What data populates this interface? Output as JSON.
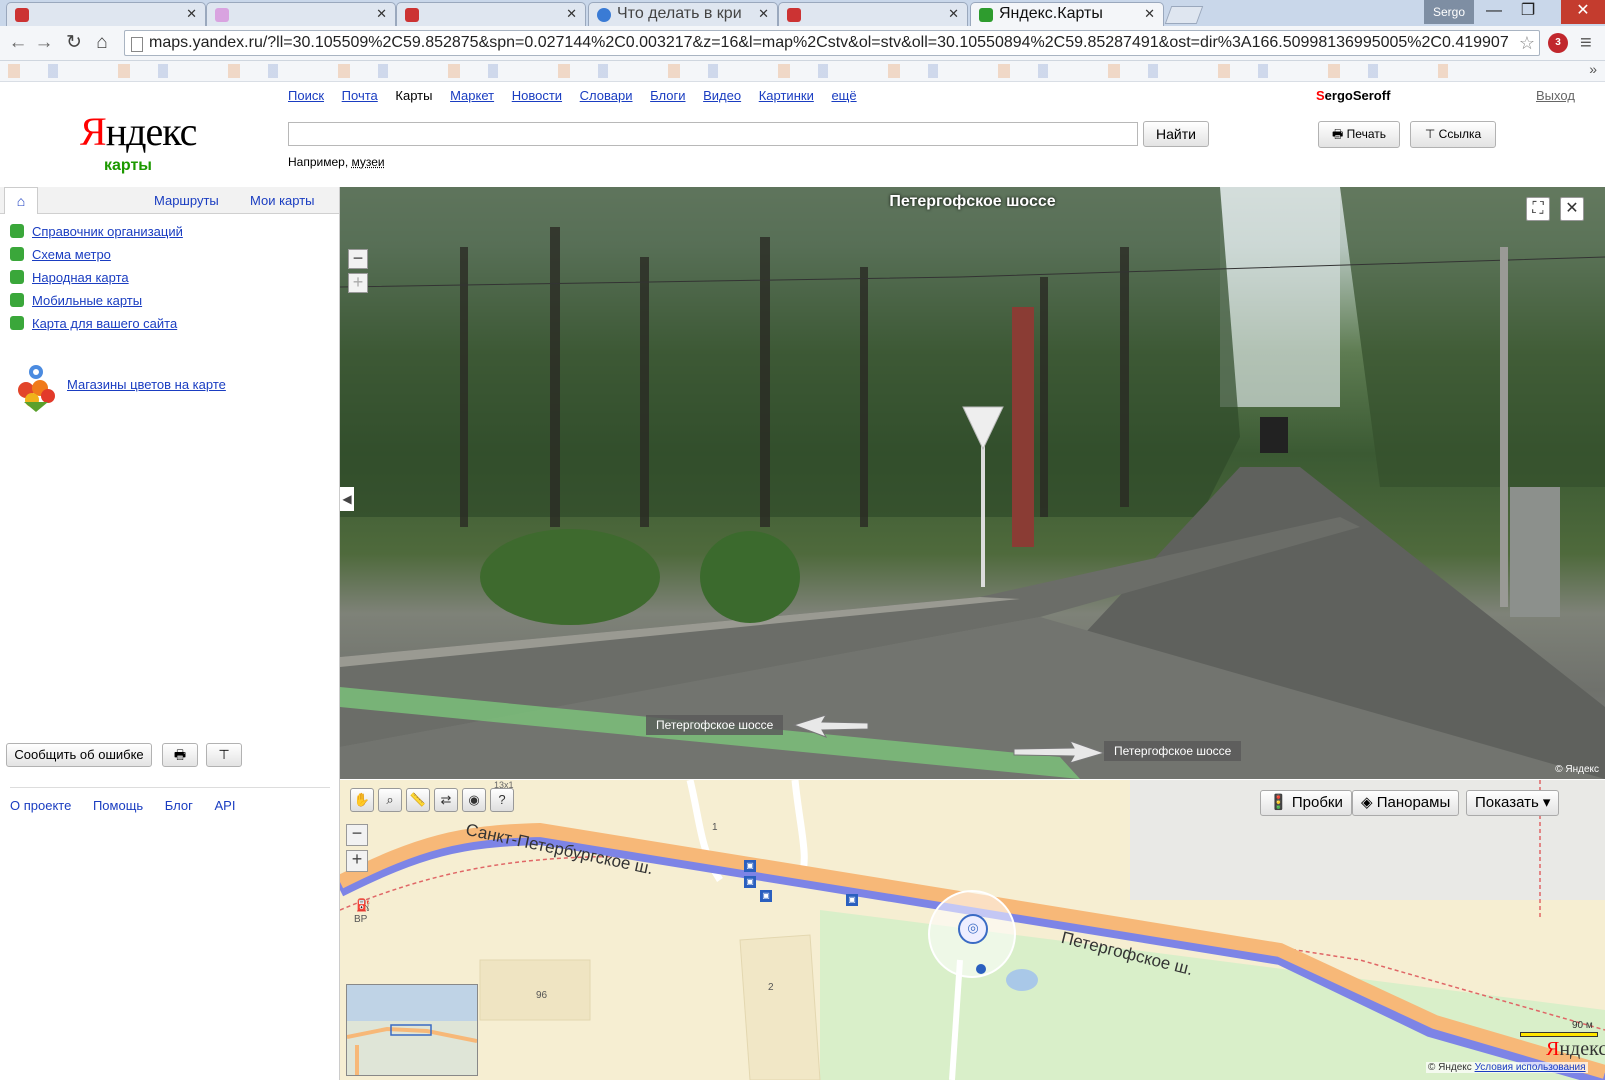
{
  "browser": {
    "tabs": [
      {
        "label": "",
        "state": "redacted"
      },
      {
        "label": "",
        "state": "redacted"
      },
      {
        "label": "",
        "state": "redacted"
      },
      {
        "label": "Что делать в кри",
        "state": "inactive"
      },
      {
        "label": "",
        "state": "redacted"
      },
      {
        "label": "Яндекс.Карты",
        "state": "active"
      }
    ],
    "profile_name": "Sergo",
    "url": "maps.yandex.ru/?ll=30.105509%2C59.852875&spn=0.027144%2C0.003217&z=16&l=map%2Cstv&ol=stv&oll=30.10550894%2C59.85287491&ost=dir%3A166.50998136995005%2C0.419907"
  },
  "header": {
    "logo": "Яндекс",
    "logo_sub": "карты",
    "services": [
      "Поиск",
      "Почта",
      "Карты",
      "Маркет",
      "Новости",
      "Словари",
      "Блоги",
      "Видео",
      "Картинки",
      "ещё"
    ],
    "current_service": "Карты",
    "search": {
      "value": "",
      "button": "Найти"
    },
    "hint_prefix": "Например,",
    "hint_example": "музеи",
    "user_first": "S",
    "user_rest": "ergoSeroff",
    "logout": "Выход",
    "print": "Печать",
    "link": "Ссылка"
  },
  "sidebar": {
    "tabs": {
      "routes": "Маршруты",
      "my_maps": "Мои карты"
    },
    "items": [
      {
        "label": "Справочник организаций",
        "color": "#3aa73a"
      },
      {
        "label": "Схема метро",
        "color": "#3aa73a"
      },
      {
        "label": "Народная карта",
        "color": "#3aa73a"
      },
      {
        "label": "Мобильные карты",
        "color": "#3aa73a"
      },
      {
        "label": "Карта для вашего сайта",
        "color": "#3aa73a"
      }
    ],
    "promo": "Магазины цветов на карте",
    "report_error": "Сообщить об ошибке",
    "footer": [
      "О проекте",
      "Помощь",
      "Блог",
      "API"
    ]
  },
  "panorama": {
    "title": "Петергофское шоссе",
    "road_label_left": "Петергофское шоссе",
    "road_label_right": "Петергофское шоссе",
    "copyright": "© Яндекс"
  },
  "map": {
    "buttons": {
      "traffic": "Пробки",
      "panoramas": "Панорамы",
      "show": "Показать ▾"
    },
    "scale_top": "13x1",
    "street_1": "Санкт-Петербургское ш.",
    "street_2": "Петергофское ш.",
    "labels": {
      "house_1": "1",
      "house_96": "96",
      "house_2": "2",
      "bp": "ВР"
    },
    "scale": "90 м",
    "logo": "Яндекс",
    "copyright": "© Яндекс",
    "terms": "Условия использования"
  },
  "colors": {
    "link": "#1a3dc1",
    "logo_red": "#ff0000",
    "maps_green": "#1c9900"
  }
}
